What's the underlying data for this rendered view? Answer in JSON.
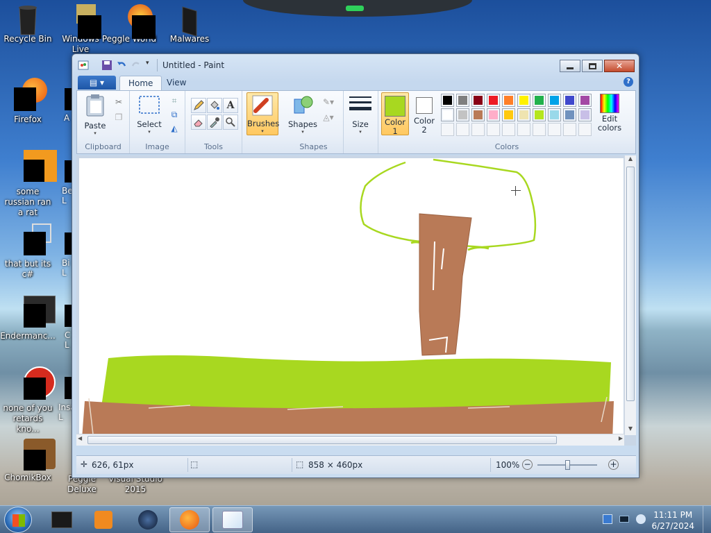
{
  "desktop": {
    "icons": [
      {
        "label": "Recycle Bin"
      },
      {
        "label": "Windows Live"
      },
      {
        "label": "Peggle World"
      },
      {
        "label": "Malwares"
      },
      {
        "label": "Firefox"
      },
      {
        "label": "some russian ran a rat"
      },
      {
        "label": "that but its c#"
      },
      {
        "label": "Endermanc..."
      },
      {
        "label": "none of you retards kno..."
      },
      {
        "label": "ChomikBox"
      },
      {
        "label": "Peggle Deluxe"
      },
      {
        "label": "Visual Studio 2015"
      }
    ],
    "partial_labels": [
      "A",
      "Be L",
      "Bi L",
      "C L",
      "Insa L"
    ]
  },
  "window": {
    "title": "Untitled - Paint",
    "tabs": [
      {
        "label": "Home"
      },
      {
        "label": "View"
      }
    ],
    "help_label": "?",
    "groups": {
      "clipboard": {
        "label": "Clipboard",
        "paste": "Paste"
      },
      "image": {
        "label": "Image",
        "select": "Select"
      },
      "tools": {
        "label": "Tools"
      },
      "brushes": {
        "label": "Brushes"
      },
      "shapes": {
        "label": "Shapes",
        "shapes_btn": "Shapes"
      },
      "size": {
        "label": "Size"
      },
      "colors": {
        "label": "Colors",
        "color1": "Color\n1",
        "color2": "Color\n2",
        "color1_label_a": "Color",
        "color1_label_b": "1",
        "color2_label_a": "Color",
        "color2_label_b": "2",
        "edit_a": "Edit",
        "edit_b": "colors",
        "color1_value": "#a8d820",
        "color2_value": "#ffffff",
        "palette_row1": [
          "#000000",
          "#7f7f7f",
          "#880015",
          "#ed1c24",
          "#ff7f27",
          "#fff200",
          "#22b14c",
          "#00a2e8",
          "#3f48cc",
          "#a349a4"
        ],
        "palette_row2": [
          "#ffffff",
          "#c3c3c3",
          "#b97a57",
          "#ffaec9",
          "#ffc90e",
          "#efe4b0",
          "#b5e61d",
          "#99d9ea",
          "#7092be",
          "#c8bfe7"
        ]
      }
    },
    "status": {
      "cursor_pos": "626, 61px",
      "canvas_size": "858 × 460px",
      "zoom": "100%"
    }
  },
  "taskbar": {
    "time": "11:11 PM",
    "date": "6/27/2024"
  },
  "colors": {
    "grass": "#a8d820",
    "trunk": "#b97a57",
    "accent": "#2f6fc9"
  }
}
